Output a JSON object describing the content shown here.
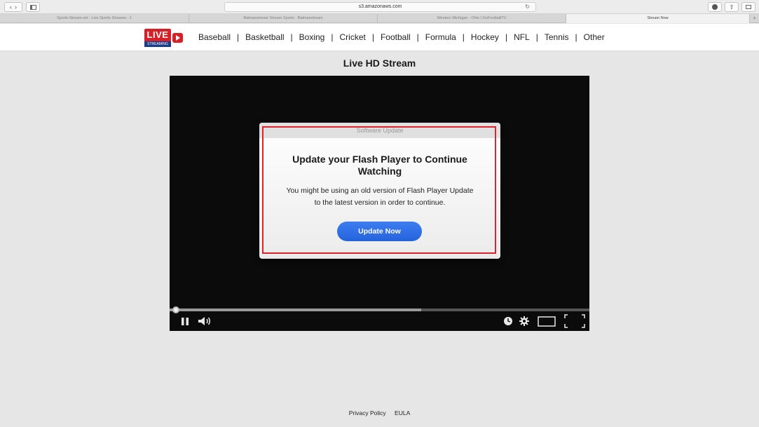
{
  "browser": {
    "url": "s3.amazonaws.com",
    "tabs": [
      {
        "label": "Sports-Stream.net - Live Sports Streams - 1",
        "active": false
      },
      {
        "label": "Batmanstream Stream Sports - Batmanstream",
        "active": false
      },
      {
        "label": "Western Michigan - Ohio | GoFootballTV",
        "active": false
      },
      {
        "label": "Stream Now",
        "active": true
      }
    ],
    "new_tab": "+"
  },
  "site": {
    "logo_text": "LIVE",
    "logo_subtext": "STREAMING",
    "nav": [
      "Baseball",
      "Basketball",
      "Boxing",
      "Cricket",
      "Football",
      "Formula",
      "Hockey",
      "NFL",
      "Tennis",
      "Other"
    ],
    "nav_separator": "|",
    "page_title": "Live HD Stream"
  },
  "player": {
    "progress_loaded": 0.6,
    "progress_played": 0.0
  },
  "dialog": {
    "header": "Software Update",
    "title": "Update your Flash Player to Continue Watching",
    "message_line1": "You might be using an old version of Flash Player Update",
    "message_line2": "to the latest version in order to continue.",
    "button": "Update Now",
    "frame_color": "#d9262d",
    "button_color": "#2f6fe6"
  },
  "footer": {
    "privacy": "Privacy Policy",
    "eula": "EULA"
  },
  "colors": {
    "page_bg": "#e6e6e6",
    "brand_red": "#d71f26",
    "brand_blue": "#1b3c8c"
  }
}
